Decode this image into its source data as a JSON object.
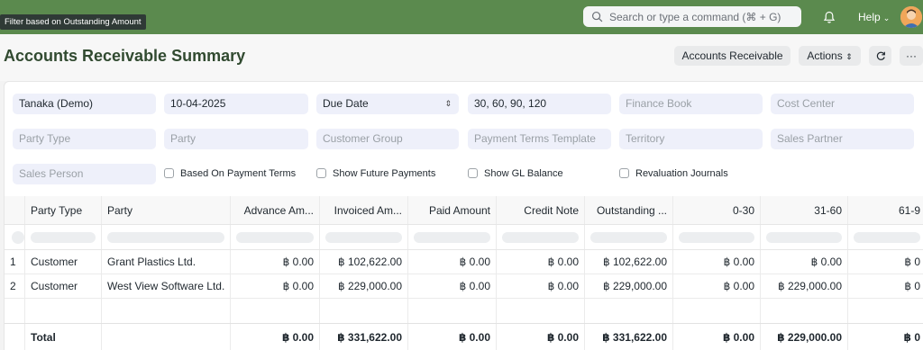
{
  "navbar": {
    "tooltip": "Filter based on Outstanding Amount",
    "search_placeholder": "Search or type a command (⌘ + G)",
    "help_label": "Help",
    "accent_color": "#5b8a4e"
  },
  "page": {
    "title": "Accounts Receivable Summary",
    "buttons": {
      "accounts_receivable": "Accounts Receivable",
      "actions": "Actions",
      "more": "···"
    }
  },
  "filters": {
    "company": "Tanaka (Demo)",
    "report_date": "10-04-2025",
    "ageing_based_on": "Due Date",
    "ranges": "30, 60, 90, 120",
    "finance_book": "Finance Book",
    "cost_center": "Cost Center",
    "party_type": "Party Type",
    "party": "Party",
    "customer_group": "Customer Group",
    "payment_terms_template": "Payment Terms Template",
    "territory": "Territory",
    "sales_partner": "Sales Partner",
    "sales_person": "Sales Person",
    "checks": {
      "based_on_payment_terms": "Based On Payment Terms",
      "show_future_payments": "Show Future Payments",
      "show_gl_balance": "Show GL Balance",
      "revaluation_journals": "Revaluation Journals"
    }
  },
  "table": {
    "columns": [
      "",
      "Party Type",
      "Party",
      "Advance Am...",
      "Invoiced Am...",
      "Paid Amount",
      "Credit Note",
      "Outstanding ...",
      "0-30",
      "31-60",
      "61-9"
    ],
    "rows": [
      [
        "1",
        "Customer",
        "Grant Plastics Ltd.",
        "฿ 0.00",
        "฿ 102,622.00",
        "฿ 0.00",
        "฿ 0.00",
        "฿ 102,622.00",
        "฿ 0.00",
        "฿ 0.00",
        "฿ 0"
      ],
      [
        "2",
        "Customer",
        "West View Software Ltd.",
        "฿ 0.00",
        "฿ 229,000.00",
        "฿ 0.00",
        "฿ 0.00",
        "฿ 229,000.00",
        "฿ 0.00",
        "฿ 229,000.00",
        "฿ 0"
      ]
    ],
    "total": [
      "",
      "Total",
      "",
      "฿ 0.00",
      "฿ 331,622.00",
      "฿ 0.00",
      "฿ 0.00",
      "฿ 331,622.00",
      "฿ 0.00",
      "฿ 229,000.00",
      "฿ 0"
    ]
  }
}
